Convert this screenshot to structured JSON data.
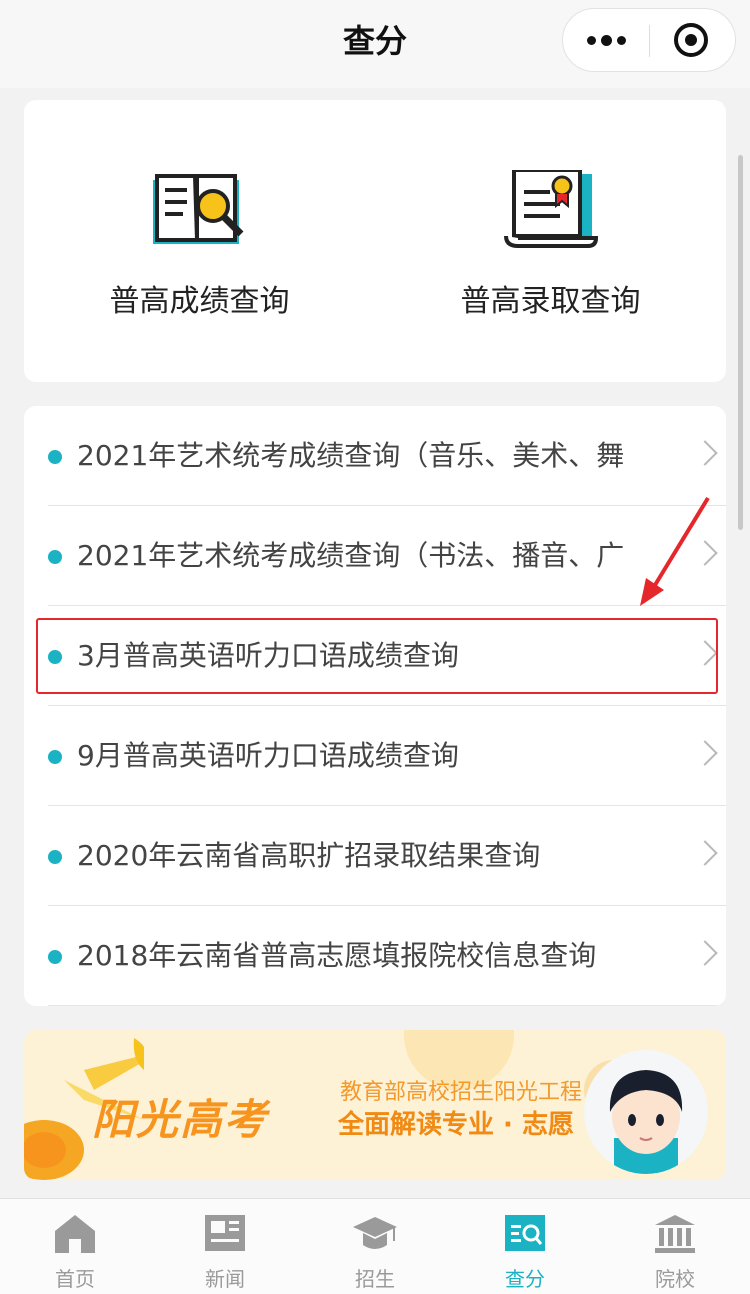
{
  "header": {
    "title": "查分"
  },
  "quick": [
    {
      "label": "普高成绩查询",
      "icon": "book-search-icon"
    },
    {
      "label": "普高录取查询",
      "icon": "certificate-icon"
    }
  ],
  "list": [
    {
      "label": "2021年艺术统考成绩查询（音乐、美术、舞"
    },
    {
      "label": "2021年艺术统考成绩查询（书法、播音、广"
    },
    {
      "label": "3月普高英语听力口语成绩查询"
    },
    {
      "label": "9月普高英语听力口语成绩查询"
    },
    {
      "label": "2020年云南省高职扩招录取结果查询"
    },
    {
      "label": "2018年云南省普高志愿填报院校信息查询"
    }
  ],
  "banner": {
    "brand": "阳光高考",
    "line1": "教育部高校招生阳光工程",
    "line2": "全面解读专业 · 志愿"
  },
  "tabs": [
    {
      "label": "首页",
      "icon": "home-icon"
    },
    {
      "label": "新闻",
      "icon": "news-icon"
    },
    {
      "label": "招生",
      "icon": "graduation-cap-icon"
    },
    {
      "label": "查分",
      "icon": "score-search-icon"
    },
    {
      "label": "院校",
      "icon": "college-icon"
    }
  ],
  "active_tab": "查分",
  "colors": {
    "accent": "#1bb3c4",
    "highlight": "#e5262b",
    "banner": "#f7941d"
  }
}
